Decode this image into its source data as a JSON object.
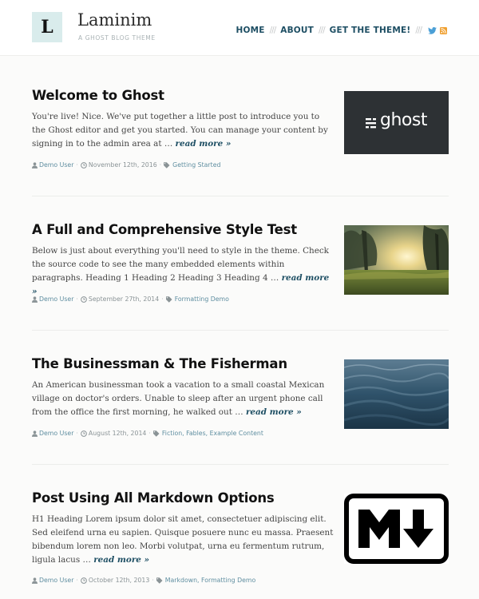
{
  "site": {
    "logo_letter": "L",
    "title": "Laminim",
    "description": "A GHOST BLOG THEME"
  },
  "nav": {
    "items": [
      {
        "label": "HOME"
      },
      {
        "label": "ABOUT"
      },
      {
        "label": "GET THE THEME!"
      }
    ],
    "separator": "///",
    "icons": [
      "twitter-icon",
      "rss-icon"
    ]
  },
  "posts": [
    {
      "title": "Welcome to Ghost",
      "excerpt": "You're live! Nice. We've put together a little post to introduce you to the Ghost editor and get you started. You can manage your content by signing in to the admin area at …",
      "read_more": "read more »",
      "author": "Demo User",
      "date": "November 12th, 2016",
      "tags": "Getting Started",
      "thumbnail": "ghost-logo",
      "thumbnail_text": "ghost"
    },
    {
      "title": "A Full and Comprehensive Style Test",
      "excerpt": "Below is just about everything you'll need to style in the theme. Check the source code to see the many embedded elements within paragraphs. Heading 1 Heading 2 Heading 3 Heading 4 …",
      "read_more": "read more »",
      "author": "Demo User",
      "date": "September 27th, 2014",
      "tags": "Formatting Demo",
      "thumbnail": "forest-sunset-photo"
    },
    {
      "title": "The Businessman & The Fisherman",
      "excerpt": "An American businessman took a vacation to a small coastal Mexican village on doctor's orders. Unable to sleep after an urgent phone call from the office the first morning, he walked out …",
      "read_more": "read more »",
      "author": "Demo User",
      "date": "August 12th, 2014",
      "tags": "Fiction, Fables, Example Content",
      "thumbnail": "ocean-water-photo"
    },
    {
      "title": "Post Using All Markdown Options",
      "excerpt": "H1 Heading Lorem ipsum dolor sit amet, consectetuer adipiscing elit. Sed eleifend urna eu sapien. Quisque posuere nunc eu massa. Praesent bibendum lorem non leo. Morbi volutpat, urna eu fermentum rutrum, ligula lacus …",
      "read_more": "read more »",
      "author": "Demo User",
      "date": "October 12th, 2013",
      "tags": "Markdown, Formatting Demo",
      "thumbnail": "markdown-logo"
    }
  ],
  "meta_separator": "·",
  "colors": {
    "accent": "#1d4e63",
    "logo_bg": "#d9ecec",
    "meta_link": "#5f8ea0",
    "ghost_thumb_bg": "#2d3134"
  }
}
